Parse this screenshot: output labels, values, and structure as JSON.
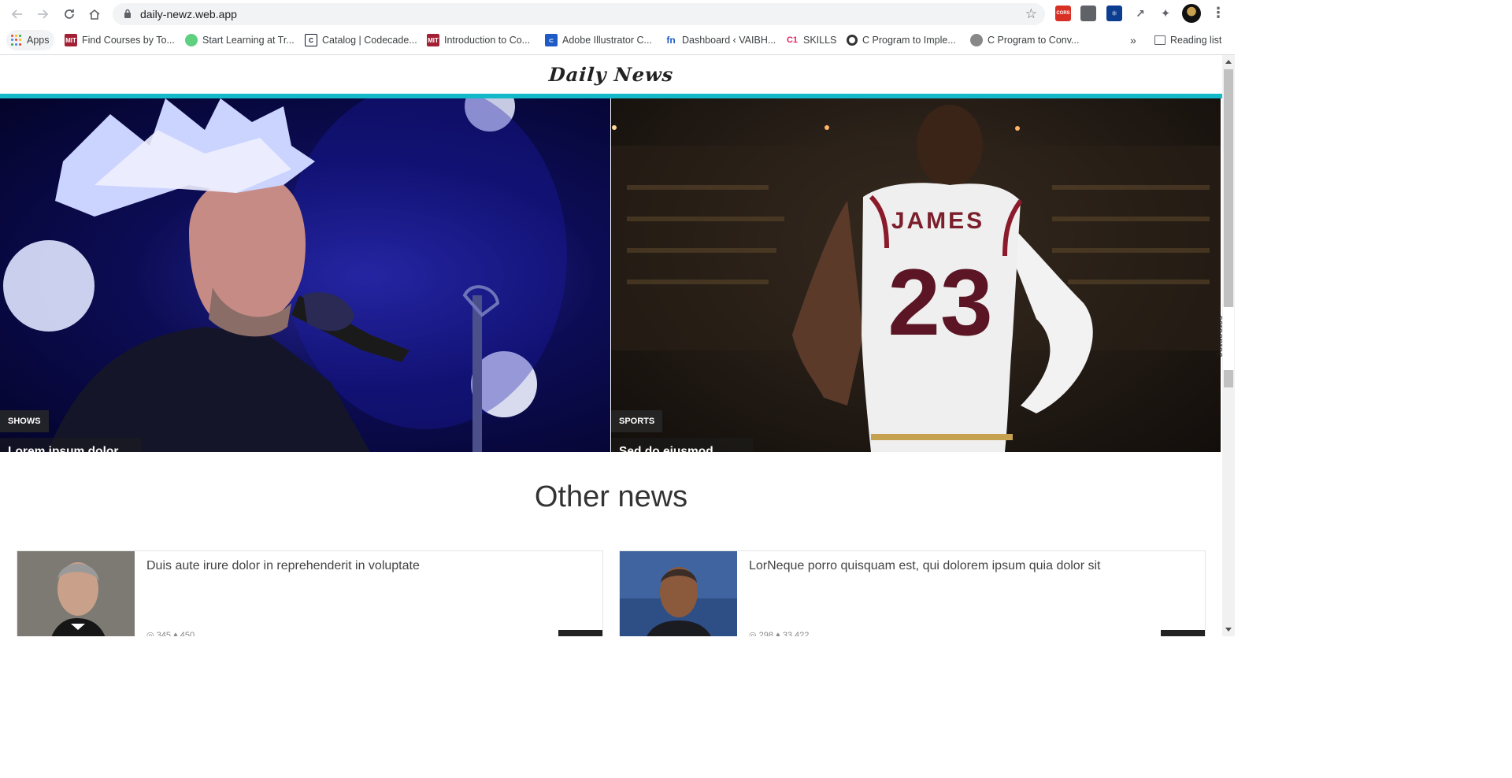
{
  "browser": {
    "url": "daily-newz.web.app",
    "bookmarks": [
      {
        "label": "Apps",
        "icon": "apps-grid-icon"
      },
      {
        "label": "Find Courses by To...",
        "icon": "mit-ocw-icon"
      },
      {
        "label": "Start Learning at Tr...",
        "icon": "treehouse-icon"
      },
      {
        "label": "Catalog | Codecade...",
        "icon": "codecademy-icon"
      },
      {
        "label": "Introduction to Co...",
        "icon": "mit-ocw-icon"
      },
      {
        "label": "Adobe Illustrator C...",
        "icon": "illustrator-icon"
      },
      {
        "label": "Dashboard ‹ VAIBH...",
        "icon": "fn-icon"
      },
      {
        "label": "SKILLS",
        "icon": "c1-icon"
      },
      {
        "label": "C Program to Imple...",
        "icon": "circle-icon"
      },
      {
        "label": "C Program to Conv...",
        "icon": "globe-icon"
      }
    ],
    "more_label": "»",
    "reading_list": "Reading list",
    "extensions": [
      {
        "label": "CORS",
        "color": "#d93025"
      },
      {
        "label": "",
        "color": "#5f6368"
      },
      {
        "label": "",
        "color": "#1a73e8"
      },
      {
        "label": "",
        "color": "#5f6368"
      }
    ]
  },
  "site": {
    "logo": "Daily News",
    "accent_color": "#13b8c9",
    "heroes": [
      {
        "category": "SHOWS",
        "title": "Lorem ipsum dolor sit amet, consectetur adipiscing elit"
      },
      {
        "category": "SPORTS",
        "title": "Sed do eiusmod tempor incididunt ut labore et dolore"
      }
    ],
    "section_title": "Other news",
    "cards": [
      {
        "title": "Duis aute irure dolor in reprehenderit in voluptate",
        "stats": "◎ 345   ♦ 450"
      },
      {
        "title": "LorNeque porro quisquam est, qui dolorem ipsum quia dolor sit",
        "stats": "◎ 298   ♦ 33 422"
      }
    ]
  },
  "jersey": {
    "name": "JAMES",
    "number": "23"
  },
  "overlay": {
    "label": "screenrec"
  }
}
